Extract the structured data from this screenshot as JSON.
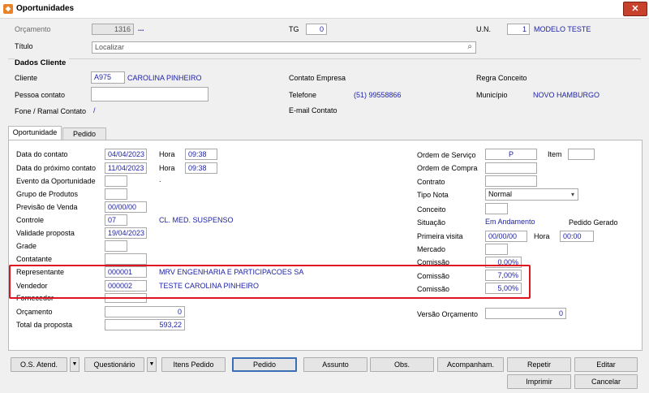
{
  "window": {
    "title": "Oportunidades",
    "close": "✕"
  },
  "header": {
    "orcamento_label": "Orçamento",
    "orcamento_value": "1316",
    "orcamento_link": "...",
    "tg_label": "TG",
    "tg_value": "0",
    "un_label": "U.N.",
    "un_value": "1",
    "un_name": "MODELO TESTE",
    "titulo_label": "Título",
    "titulo_placeholder": "Localizar"
  },
  "dados_cliente": {
    "section_title": "Dados Cliente",
    "cliente_label": "Cliente",
    "cliente_code": "A975",
    "cliente_name": "CAROLINA PINHEIRO",
    "contato_empresa_label": "Contato Empresa",
    "regra_conceito_label": "Regra Conceito",
    "pessoa_contato_label": "Pessoa contato",
    "pessoa_contato_value": "",
    "telefone_label": "Telefone",
    "telefone_value": "(51) 99558866",
    "municipio_label": "Município",
    "municipio_value": "NOVO HAMBURGO",
    "fone_ramal_label": "Fone / Ramal Contato",
    "fone_ramal_value": "/",
    "email_contato_label": "E-mail Contato"
  },
  "tabs": [
    {
      "label": "Oportunidade"
    },
    {
      "label": "Pedido"
    }
  ],
  "left_form": {
    "data_contato_label": "Data do contato",
    "data_contato_value": "04/04/2023",
    "hora_label": "Hora",
    "hora_value": "09:38",
    "data_proximo_label": "Data do próximo contato",
    "data_proximo_value": "11/04/2023",
    "hora2_label": "Hora",
    "hora2_value": "09:38",
    "evento_label": "Evento da Oportunidade",
    "evento_value": "",
    "evento_dot": ".",
    "grupo_label": "Grupo de Produtos",
    "grupo_value": "",
    "previsao_label": "Previsão de Venda",
    "previsao_value": "00/00/00",
    "controle_label": "Controle",
    "controle_value": "07",
    "controle_desc": "CL. MED. SUSPENSO",
    "validade_label": "Validade proposta",
    "validade_value": "19/04/2023",
    "grade_label": "Grade",
    "grade_value": "",
    "contatante_label": "Contatante",
    "contatante_value": "",
    "representante_label": "Representante",
    "representante_code": "000001",
    "representante_name": "MRV ENGENHARIA E PARTICIPACOES SA",
    "vendedor_label": "Vendedor",
    "vendedor_code": "000002",
    "vendedor_name": "TESTE CAROLINA PINHEIRO",
    "fornecedor_label": "Fornecedor",
    "fornecedor_value": "",
    "orcamento_label": "Orçamento",
    "orcamento_value": "0",
    "total_label": "Total da proposta",
    "total_value": "593,22"
  },
  "right_form": {
    "ordem_servico_label": "Ordem de Serviço",
    "ordem_servico_value": "P",
    "item_label": "Item",
    "item_value": "",
    "ordem_compra_label": "Ordem de Compra",
    "ordem_compra_value": "",
    "contrato_label": "Contrato",
    "contrato_value": "",
    "tipo_nota_label": "Tipo Nota",
    "tipo_nota_value": "Normal",
    "conceito_label": "Conceito",
    "conceito_value": "",
    "situacao_label": "Situação",
    "situacao_value": "Em Andamento",
    "pedido_gerado_label": "Pedido Gerado",
    "primeira_visita_label": "Primeira visita",
    "primeira_visita_value": "00/00/00",
    "hora_label": "Hora",
    "hora_value": "00:00",
    "mercado_label": "Mercado",
    "mercado_value": "",
    "comissao1_label": "Comissão",
    "comissao1_value": "0,00%",
    "comissao2_label": "Comissão",
    "comissao2_value": "7,00%",
    "comissao3_label": "Comissão",
    "comissao3_value": "5,00%",
    "versao_label": "Versão Orçamento",
    "versao_value": "0"
  },
  "buttons": {
    "os_atend": "O.S. Atend.",
    "questionario": "Questionário",
    "itens_pedido": "Itens Pedido",
    "pedido": "Pedido",
    "assunto": "Assunto",
    "obs": "Obs.",
    "acompanham": "Acompanham.",
    "repetir": "Repetir",
    "editar": "Editar",
    "imprimir": "Imprimir",
    "cancelar": "Cancelar"
  },
  "colors": {
    "accent_blue": "#1f23a8",
    "highlight_red": "#e0141e"
  }
}
